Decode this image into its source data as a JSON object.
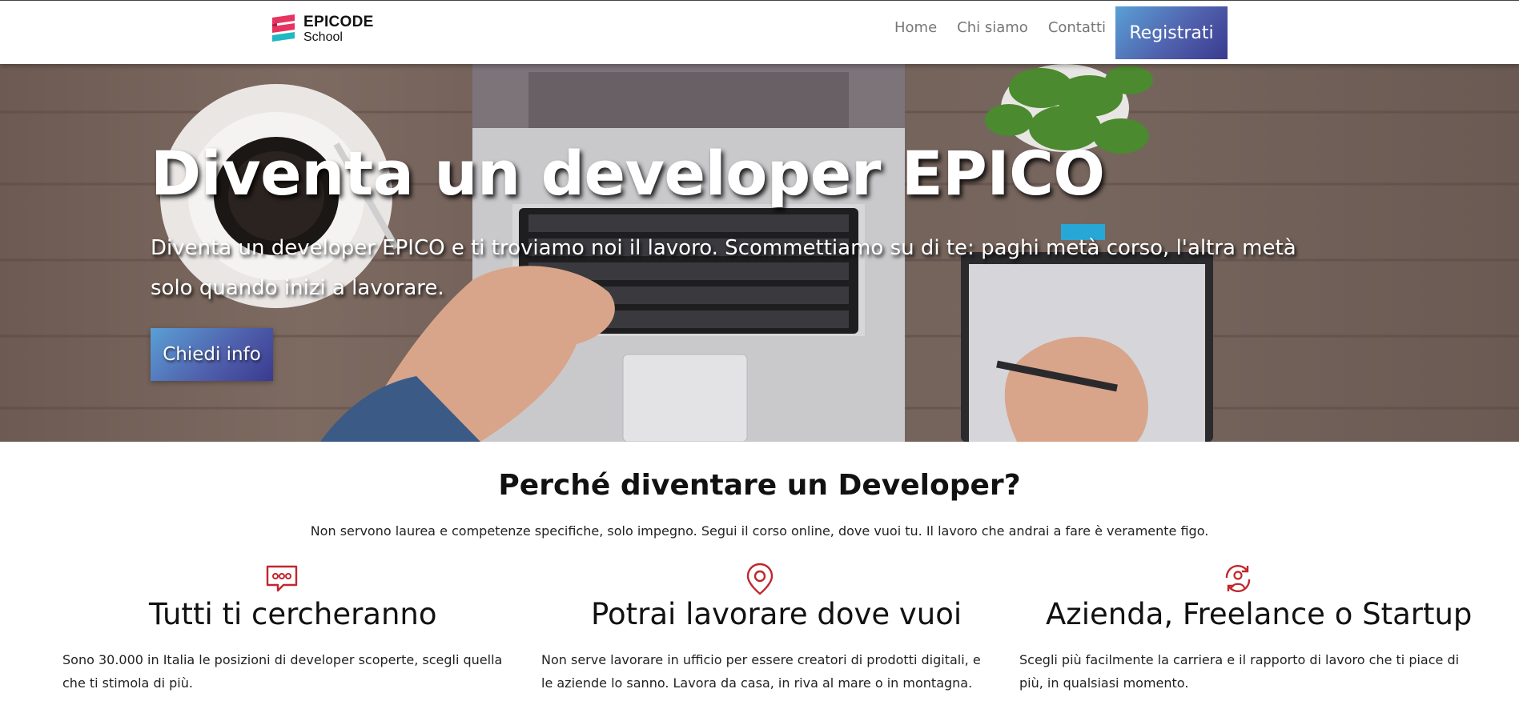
{
  "header": {
    "logo": {
      "brand": "EPICODE",
      "sub": "School"
    },
    "nav": [
      "Home",
      "Chi siamo",
      "Contatti"
    ],
    "register_label": "Registrati"
  },
  "hero": {
    "title": "Diventa un developer EPICO",
    "text": "Diventa un developer EPICO e ti troviamo noi il lavoro. Scommettiamo su di te: paghi metà corso, l'altra metà solo quando inizi a lavorare.",
    "button_label": "Chiedi info"
  },
  "why": {
    "title": "Perché diventare un Developer?",
    "subtitle": "Non servono laurea e competenze specifiche, solo impegno. Segui il corso online, dove vuoi tu. Il lavoro che andrai a fare è veramente figo."
  },
  "features": [
    {
      "icon": "chat-bubble-icon",
      "title": "Tutti ti cercheranno",
      "text": "Sono 30.000 in Italia le posizioni di developer scoperte, scegli quella che ti stimola di più."
    },
    {
      "icon": "location-pin-icon",
      "title": "Potrai lavorare dove vuoi",
      "text": "Non serve lavorare in ufficio per essere creatori di prodotti digitali, e le aziende lo sanno. Lavora da casa, in riva al mare o in montagna."
    },
    {
      "icon": "user-refresh-icon",
      "title": "Azienda, Freelance o Startup",
      "text": "Scegli più facilmente la carriera e il rapporto di lavoro che ti piace di più, in qualsiasi momento."
    }
  ],
  "colors": {
    "accent_gradient_start": "#5aa0d6",
    "accent_gradient_end": "#3a3a8f",
    "icon_red": "#c0272d",
    "logo_pink": "#e8325f",
    "logo_teal": "#1fb8c3"
  }
}
